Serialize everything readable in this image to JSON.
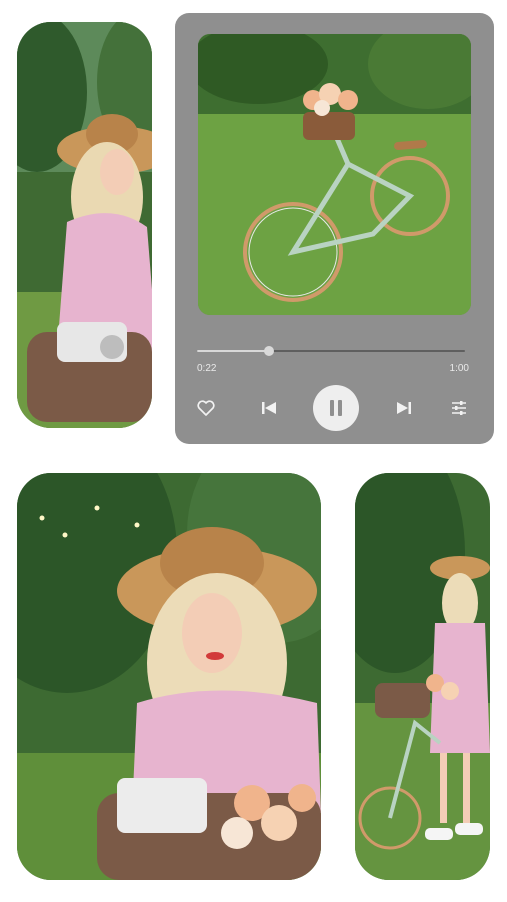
{
  "player": {
    "elapsed_time": "0:22",
    "total_time": "1:00",
    "progress_fraction": 0.27,
    "colors": {
      "card": "#8f8f8f",
      "track": "#5f5f5f",
      "track_fill": "#d8d8d8",
      "icon": "#f2f2f2"
    },
    "icons": [
      "heart-icon",
      "previous-track-icon",
      "pause-icon",
      "next-track-icon",
      "equalizer-icon"
    ]
  }
}
